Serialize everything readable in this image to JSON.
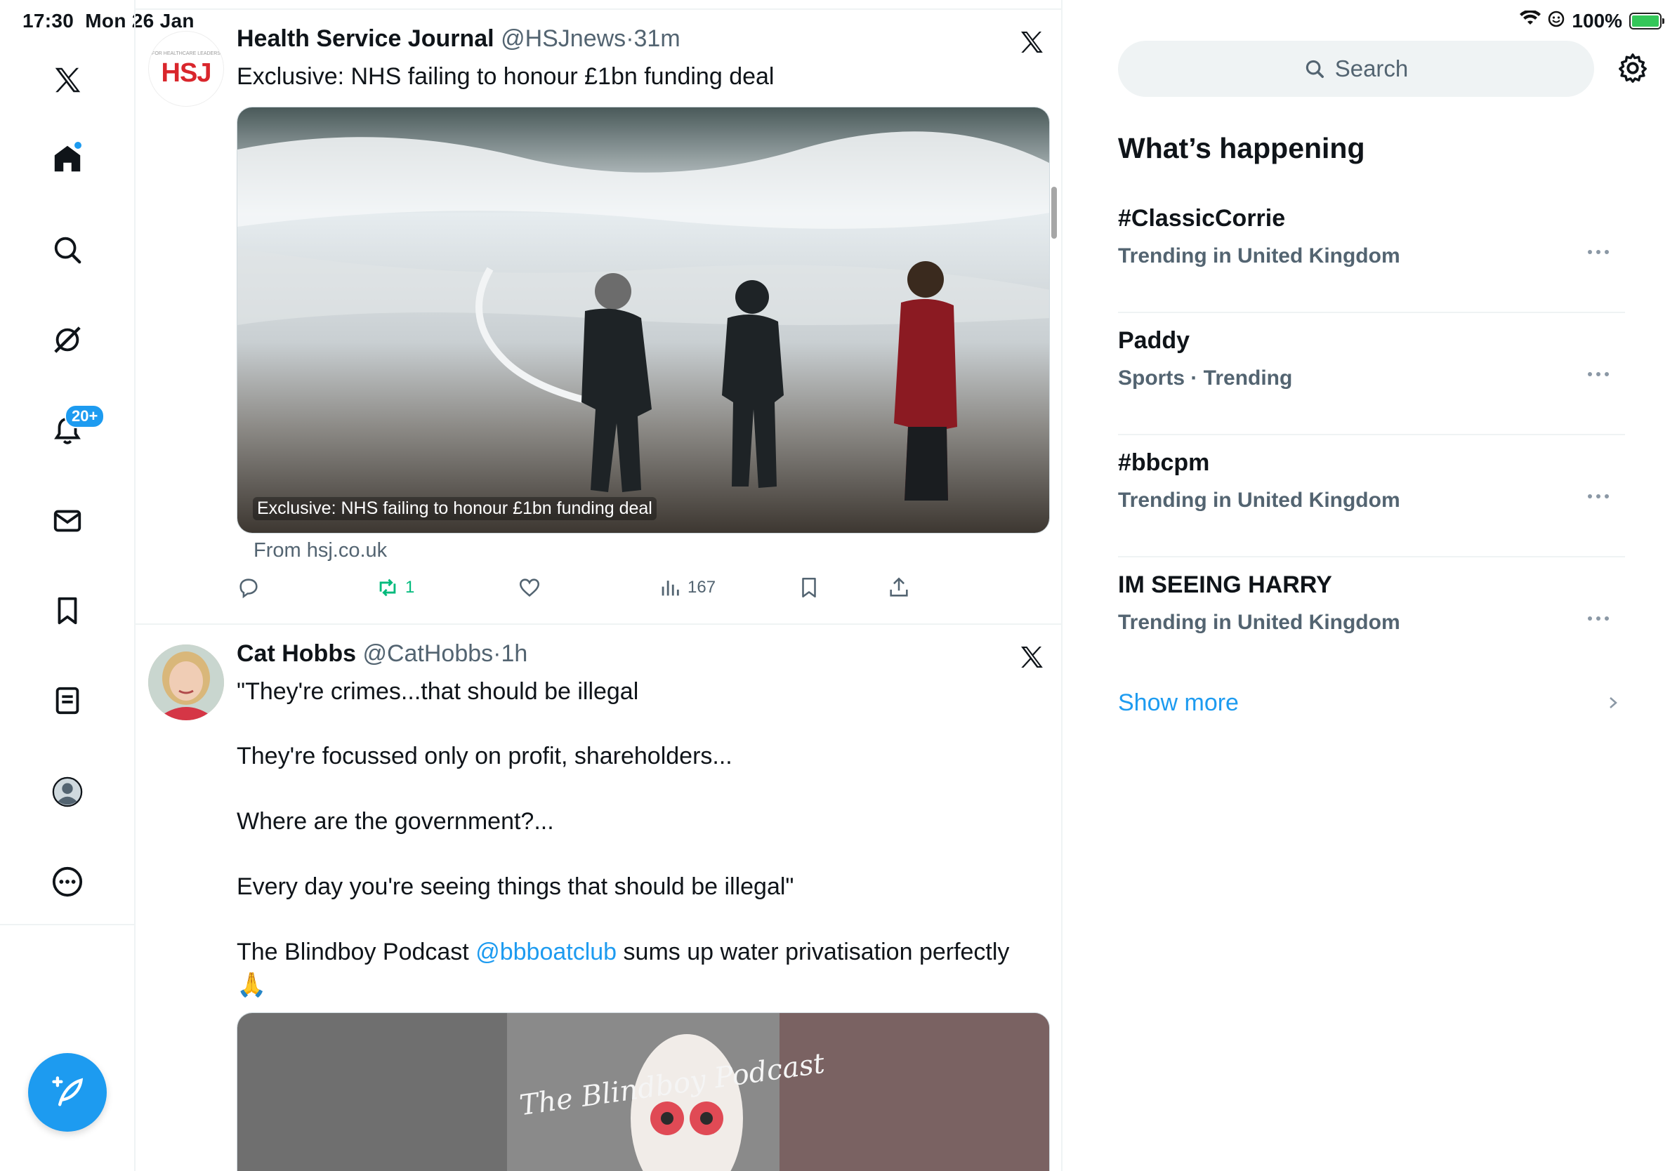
{
  "status_bar": {
    "time": "17:30",
    "date": "Mon 26 Jan",
    "battery": "100%"
  },
  "nav": {
    "items": [
      {
        "name": "x-logo"
      },
      {
        "name": "home",
        "has_dot": true
      },
      {
        "name": "search"
      },
      {
        "name": "grok"
      },
      {
        "name": "notifications",
        "badge": "20+"
      },
      {
        "name": "messages"
      },
      {
        "name": "bookmarks"
      },
      {
        "name": "lists"
      },
      {
        "name": "profile"
      },
      {
        "name": "more"
      }
    ],
    "accent": "#1d9bf0"
  },
  "feed": {
    "tweets": [
      {
        "author_name": "Health Service Journal",
        "handle": "@HSJnews",
        "sep": "·",
        "time": "31m",
        "avatar_text": "HSJ",
        "avatar_subtext": "FOR HEALTHCARE LEADERS",
        "text": "Exclusive: NHS failing to honour £1bn funding deal",
        "media_caption": "Exclusive: NHS failing to honour £1bn funding deal",
        "source": "From hsj.co.uk",
        "retweets": "1",
        "views": "167"
      },
      {
        "author_name": "Cat Hobbs",
        "handle": "@CatHobbs",
        "sep": "·",
        "time": "1h",
        "text_parts": [
          "\"They're crimes...that should be illegal",
          "They're focussed only on profit, shareholders...",
          "Where are the government?...",
          "Every day you're seeing things that should be illegal\"",
          "The Blindboy Podcast ",
          "@bbboatclub",
          " sums up water privatisation perfectly",
          "🙏"
        ],
        "media_title": "The Blindboy Podcast"
      }
    ]
  },
  "right": {
    "search_placeholder": "Search",
    "whats_happening": "What’s happening",
    "trends": [
      {
        "name": "#ClassicCorrie",
        "sub": "Trending in United Kingdom"
      },
      {
        "name": "Paddy",
        "sub": "Sports · Trending"
      },
      {
        "name": "#bbcpm",
        "sub": "Trending in United Kingdom"
      },
      {
        "name": "IM SEEING HARRY",
        "sub": "Trending in United Kingdom"
      }
    ],
    "show_more": "Show more"
  }
}
